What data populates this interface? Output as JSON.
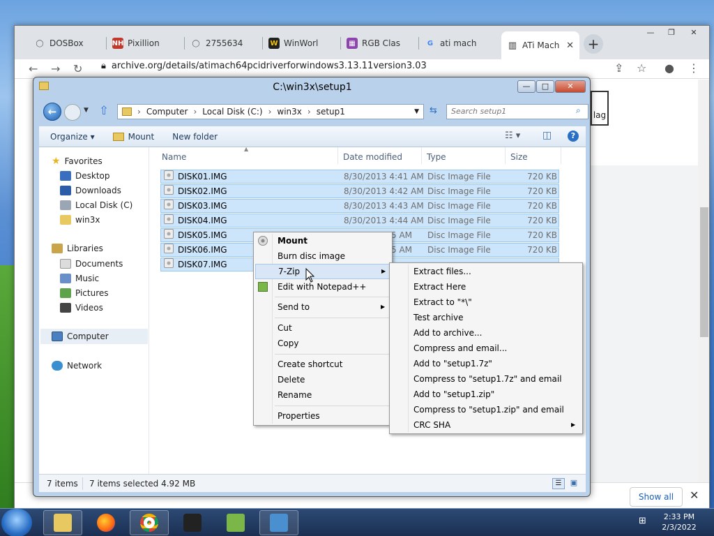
{
  "chrome": {
    "tabs": [
      {
        "label": "DOSBox",
        "fav_color": "#555555",
        "fav_char": "◯"
      },
      {
        "label": "Pixillion",
        "fav_color": "#c0392b",
        "fav_char": "NH"
      },
      {
        "label": "2755634",
        "fav_color": "#555555",
        "fav_char": "◯"
      },
      {
        "label": "WinWorl",
        "fav_color": "#222222",
        "fav_char": "W"
      },
      {
        "label": "RGB Clas",
        "fav_color": "#8e44ad",
        "fav_char": "▦"
      },
      {
        "label": "ati mach",
        "fav_color": "#4285f4",
        "fav_char": "G"
      },
      {
        "label": "ATi Mach",
        "fav_color": "#333333",
        "fav_char": "▥"
      }
    ],
    "new_tab": "+",
    "url": "archive.org/details/atimach64pcidriverforwindows3.13.11version3.03",
    "flag_label": "lag",
    "download_bar": {
      "show_all": "Show all",
      "close": "✕"
    }
  },
  "explorer": {
    "title": "C:\\win3x\\setup1",
    "controls": {
      "minimize": "—",
      "maximize": "□",
      "close": "✕"
    },
    "breadcrumb": [
      "Computer",
      "Local Disk (C:)",
      "win3x",
      "setup1"
    ],
    "search_placeholder": "Search setup1",
    "commands": {
      "organize": "Organize ▾",
      "mount": "Mount",
      "new_folder": "New folder"
    },
    "nav": {
      "favorites": "Favorites",
      "desktop": "Desktop",
      "downloads": "Downloads",
      "local_disk": "Local Disk (C)",
      "win3x": "win3x",
      "libraries": "Libraries",
      "documents": "Documents",
      "music": "Music",
      "pictures": "Pictures",
      "videos": "Videos",
      "computer": "Computer",
      "network": "Network"
    },
    "columns": {
      "name": "Name",
      "date": "Date modified",
      "type": "Type",
      "size": "Size"
    },
    "files": [
      {
        "name": "DISK01.IMG",
        "date": "8/30/2013 4:41 AM",
        "type": "Disc Image File",
        "size": "720 KB"
      },
      {
        "name": "DISK02.IMG",
        "date": "8/30/2013 4:42 AM",
        "type": "Disc Image File",
        "size": "720 KB"
      },
      {
        "name": "DISK03.IMG",
        "date": "8/30/2013 4:43 AM",
        "type": "Disc Image File",
        "size": "720 KB"
      },
      {
        "name": "DISK04.IMG",
        "date": "8/30/2013 4:44 AM",
        "type": "Disc Image File",
        "size": "720 KB"
      },
      {
        "name": "DISK05.IMG",
        "date": "5 AM",
        "type": "Disc Image File",
        "size": "720 KB"
      },
      {
        "name": "DISK06.IMG",
        "date": "5 AM",
        "type": "Disc Image File",
        "size": "720 KB"
      },
      {
        "name": "DISK07.IMG",
        "date": "",
        "type": "",
        "size": ""
      }
    ],
    "status": {
      "items": "7 items",
      "selected": "7 items selected  4.92 MB"
    }
  },
  "context_menu": {
    "mount": "Mount",
    "burn": "Burn disc image",
    "sevenzip": "7-Zip",
    "notepad": "Edit with Notepad++",
    "send_to": "Send to",
    "cut": "Cut",
    "copy": "Copy",
    "create_shortcut": "Create shortcut",
    "delete": "Delete",
    "rename": "Rename",
    "properties": "Properties"
  },
  "zip_menu": {
    "extract_files": "Extract files...",
    "extract_here": "Extract Here",
    "extract_to": "Extract to \"*\\\"",
    "test": "Test archive",
    "add": "Add to archive...",
    "compress_email": "Compress and email...",
    "add_7z": "Add to \"setup1.7z\"",
    "compress_7z_email": "Compress to \"setup1.7z\" and email",
    "add_zip": "Add to \"setup1.zip\"",
    "compress_zip_email": "Compress to \"setup1.zip\" and email",
    "crc": "CRC SHA"
  },
  "taskbar": {
    "time": "2:33 PM",
    "date": "2/3/2022"
  }
}
